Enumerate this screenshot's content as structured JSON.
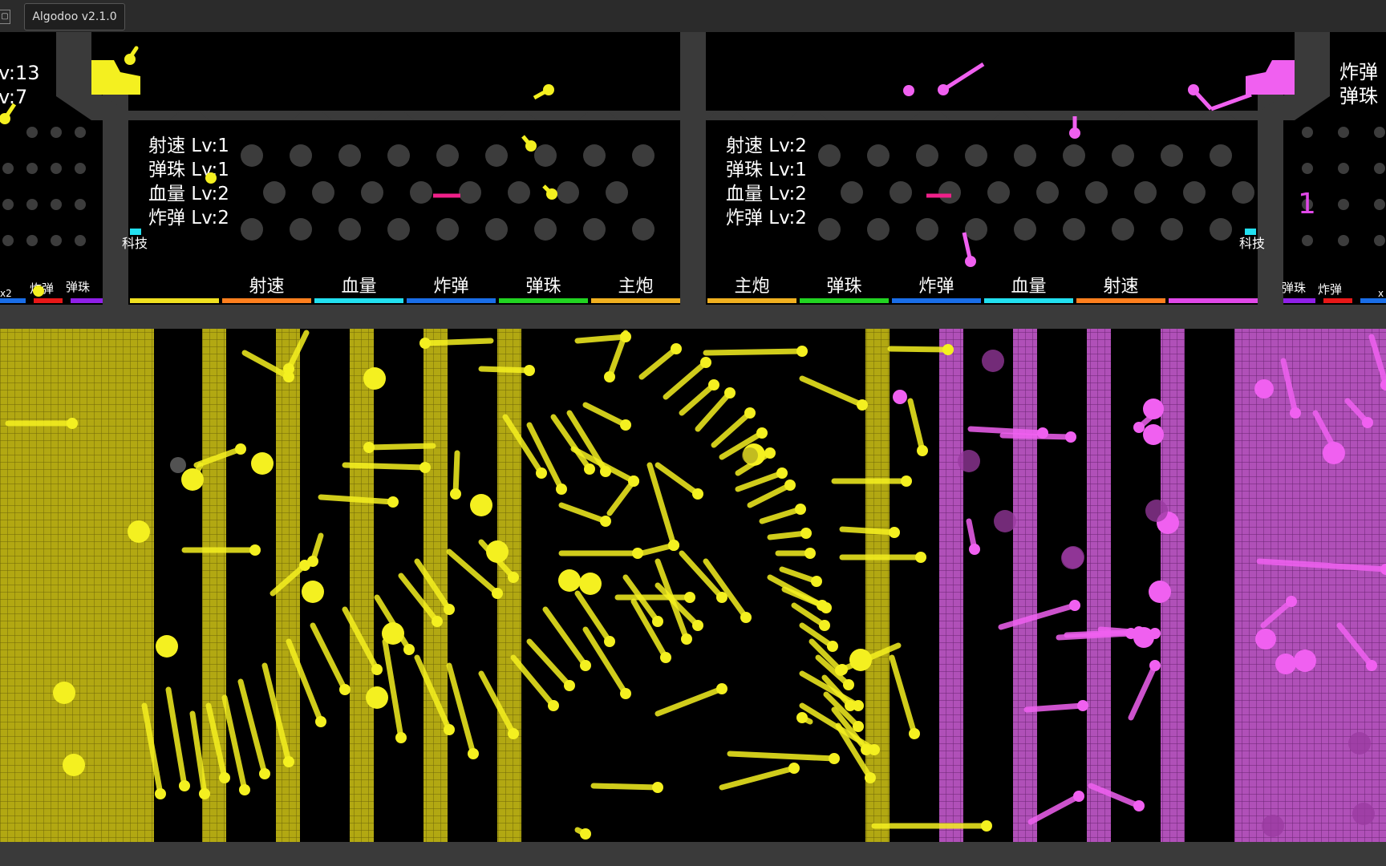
{
  "window": {
    "title": "Algodoo v2.1.0"
  },
  "left_edge": {
    "lv_top": "v:13",
    "lv_bottom": "v:7",
    "labels": [
      "x2",
      "炸弹",
      "弹珠"
    ]
  },
  "right_edge": {
    "labels_top": [
      "炸弹",
      "弹珠"
    ],
    "counter": "1",
    "labels": [
      "弹珠",
      "炸弹",
      "x"
    ]
  },
  "yellow_panel": {
    "stats": [
      "射速 Lv:1",
      "弹珠 Lv:1",
      "血量 Lv:2",
      "炸弹 Lv:2"
    ],
    "tech_label": "科技",
    "zones": [
      {
        "label": "",
        "color": "#f0e020"
      },
      {
        "label": "射速",
        "color": "#ff7f1e"
      },
      {
        "label": "血量",
        "color": "#22e0f0"
      },
      {
        "label": "炸弹",
        "color": "#1a6ee8"
      },
      {
        "label": "弹珠",
        "color": "#22d422"
      },
      {
        "label": "主炮",
        "color": "#f0b020"
      }
    ]
  },
  "magenta_panel": {
    "stats": [
      "射速 Lv:2",
      "弹珠 Lv:1",
      "血量 Lv:2",
      "炸弹 Lv:2"
    ],
    "tech_label": "科技",
    "zones": [
      {
        "label": "主炮",
        "color": "#f0b020"
      },
      {
        "label": "弹珠",
        "color": "#22d422"
      },
      {
        "label": "炸弹",
        "color": "#1a6ee8"
      },
      {
        "label": "血量",
        "color": "#22e0f0"
      },
      {
        "label": "射速",
        "color": "#ff7f1e"
      },
      {
        "label": "",
        "color": "#e048e8"
      }
    ]
  },
  "colors": {
    "yellow_team": "#f4f020",
    "yellow_wall": "#b2a812",
    "magenta_team": "#f060f0",
    "magenta_wall": "#b050b8",
    "frame": "#3a3a3a"
  }
}
